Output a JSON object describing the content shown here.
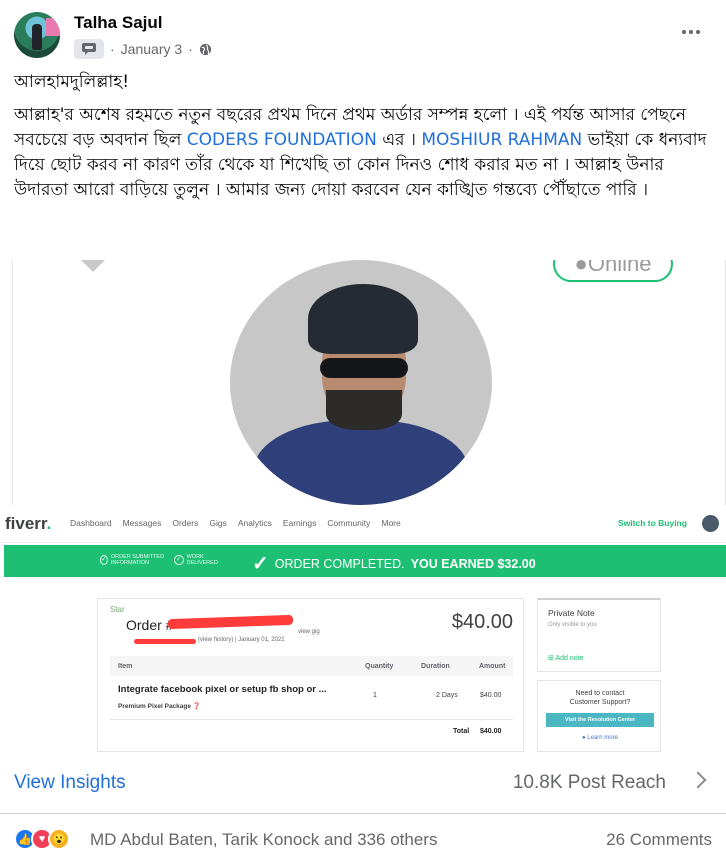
{
  "post": {
    "author": "Talha Sajul",
    "date": "January 3",
    "separator": "·",
    "line1": "আলহামদুলিল্লাহ!",
    "para_part1": "আল্লাহ'র অশেষ রহমতে নতুন বছরের প্রথম দিনে প্রথম অর্ডার সম্পন্ন হলো । এই পর্যন্ত আসার পেছনে সবচেয়ে বড় অবদান ছিল ",
    "link1": "CODERS FOUNDATION",
    "para_part2": " এর । ",
    "link2": "MOSHIUR RAHMAN",
    "para_part3": " ভাইয়া কে ধন্যবাদ দিয়ে ছোট করব না কারণ তাঁর থেকে যা শিখেছি তা কোন দিনও শোধ করার মত না । আল্লাহ উনার উদারতা আরো বাড়িয়ে তুলুন । আমার জন্য দোয়া করবেন যেন কাঙ্খিত গন্তব্যে পৌঁছাতে পারি ।"
  },
  "image": {
    "online_label": "Online",
    "fiverr": {
      "logo": "fiverr",
      "logo_dot": ".",
      "nav": [
        "Dashboard",
        "Messages",
        "Orders",
        "Gigs",
        "Analytics",
        "Earnings",
        "Community",
        "More"
      ],
      "switch_label": "Switch to Buying",
      "step1": "ORDER SUBMITTED INFORMATION",
      "step2": "WORK DELIVERED",
      "banner_text": "ORDER COMPLETED.",
      "banner_earned": "YOU EARNED $32.00",
      "star_label": "Star",
      "order_label": "Order #",
      "order_sub": "(view history)  |  January 01, 2021",
      "new_gig": "view gig",
      "price": "$40.00",
      "table_headers": [
        "Item",
        "Quantity",
        "Duration",
        "Amount"
      ],
      "item_title": "Integrate facebook pixel or setup fb shop or ...",
      "item_package": "Premium Pixel Package",
      "item_qty": "1",
      "item_duration": "2 Days",
      "item_amount": "$40.00",
      "total_label": "Total",
      "total_value": "$40.00",
      "note_title": "Private Note",
      "note_sub": "Only visible to you",
      "note_add": "Add note",
      "support_text1": "Need to contact",
      "support_text2": "Customer Support?",
      "support_button": "Visit the Resolution Center",
      "learn_more": "Learn more"
    }
  },
  "insights": {
    "view_label": "View Insights",
    "reach_label": "10.8K Post Reach"
  },
  "reactions": {
    "names": "MD Abdul Baten, Tarik Konock and 336 others",
    "comments": "26 Comments"
  },
  "colors": {
    "link": "#216fdb",
    "fiverr_green": "#1dbf73",
    "like_blue": "#1877f2",
    "love_red": "#f33e58",
    "wow_yellow": "#f7b125"
  }
}
